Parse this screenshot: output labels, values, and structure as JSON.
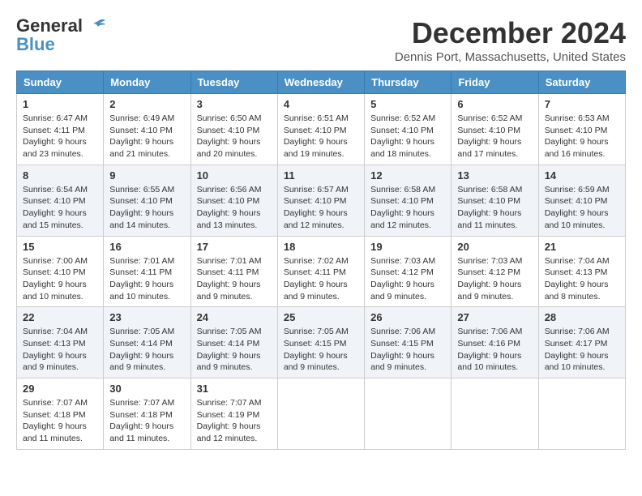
{
  "logo": {
    "line1": "General",
    "line2": "Blue"
  },
  "title": "December 2024",
  "location": "Dennis Port, Massachusetts, United States",
  "days_of_week": [
    "Sunday",
    "Monday",
    "Tuesday",
    "Wednesday",
    "Thursday",
    "Friday",
    "Saturday"
  ],
  "weeks": [
    [
      {
        "day": "1",
        "sunrise": "6:47 AM",
        "sunset": "4:11 PM",
        "daylight": "9 hours and 23 minutes."
      },
      {
        "day": "2",
        "sunrise": "6:49 AM",
        "sunset": "4:10 PM",
        "daylight": "9 hours and 21 minutes."
      },
      {
        "day": "3",
        "sunrise": "6:50 AM",
        "sunset": "4:10 PM",
        "daylight": "9 hours and 20 minutes."
      },
      {
        "day": "4",
        "sunrise": "6:51 AM",
        "sunset": "4:10 PM",
        "daylight": "9 hours and 19 minutes."
      },
      {
        "day": "5",
        "sunrise": "6:52 AM",
        "sunset": "4:10 PM",
        "daylight": "9 hours and 18 minutes."
      },
      {
        "day": "6",
        "sunrise": "6:52 AM",
        "sunset": "4:10 PM",
        "daylight": "9 hours and 17 minutes."
      },
      {
        "day": "7",
        "sunrise": "6:53 AM",
        "sunset": "4:10 PM",
        "daylight": "9 hours and 16 minutes."
      }
    ],
    [
      {
        "day": "8",
        "sunrise": "6:54 AM",
        "sunset": "4:10 PM",
        "daylight": "9 hours and 15 minutes."
      },
      {
        "day": "9",
        "sunrise": "6:55 AM",
        "sunset": "4:10 PM",
        "daylight": "9 hours and 14 minutes."
      },
      {
        "day": "10",
        "sunrise": "6:56 AM",
        "sunset": "4:10 PM",
        "daylight": "9 hours and 13 minutes."
      },
      {
        "day": "11",
        "sunrise": "6:57 AM",
        "sunset": "4:10 PM",
        "daylight": "9 hours and 12 minutes."
      },
      {
        "day": "12",
        "sunrise": "6:58 AM",
        "sunset": "4:10 PM",
        "daylight": "9 hours and 12 minutes."
      },
      {
        "day": "13",
        "sunrise": "6:58 AM",
        "sunset": "4:10 PM",
        "daylight": "9 hours and 11 minutes."
      },
      {
        "day": "14",
        "sunrise": "6:59 AM",
        "sunset": "4:10 PM",
        "daylight": "9 hours and 10 minutes."
      }
    ],
    [
      {
        "day": "15",
        "sunrise": "7:00 AM",
        "sunset": "4:10 PM",
        "daylight": "9 hours and 10 minutes."
      },
      {
        "day": "16",
        "sunrise": "7:01 AM",
        "sunset": "4:11 PM",
        "daylight": "9 hours and 10 minutes."
      },
      {
        "day": "17",
        "sunrise": "7:01 AM",
        "sunset": "4:11 PM",
        "daylight": "9 hours and 9 minutes."
      },
      {
        "day": "18",
        "sunrise": "7:02 AM",
        "sunset": "4:11 PM",
        "daylight": "9 hours and 9 minutes."
      },
      {
        "day": "19",
        "sunrise": "7:03 AM",
        "sunset": "4:12 PM",
        "daylight": "9 hours and 9 minutes."
      },
      {
        "day": "20",
        "sunrise": "7:03 AM",
        "sunset": "4:12 PM",
        "daylight": "9 hours and 9 minutes."
      },
      {
        "day": "21",
        "sunrise": "7:04 AM",
        "sunset": "4:13 PM",
        "daylight": "9 hours and 8 minutes."
      }
    ],
    [
      {
        "day": "22",
        "sunrise": "7:04 AM",
        "sunset": "4:13 PM",
        "daylight": "9 hours and 9 minutes."
      },
      {
        "day": "23",
        "sunrise": "7:05 AM",
        "sunset": "4:14 PM",
        "daylight": "9 hours and 9 minutes."
      },
      {
        "day": "24",
        "sunrise": "7:05 AM",
        "sunset": "4:14 PM",
        "daylight": "9 hours and 9 minutes."
      },
      {
        "day": "25",
        "sunrise": "7:05 AM",
        "sunset": "4:15 PM",
        "daylight": "9 hours and 9 minutes."
      },
      {
        "day": "26",
        "sunrise": "7:06 AM",
        "sunset": "4:15 PM",
        "daylight": "9 hours and 9 minutes."
      },
      {
        "day": "27",
        "sunrise": "7:06 AM",
        "sunset": "4:16 PM",
        "daylight": "9 hours and 10 minutes."
      },
      {
        "day": "28",
        "sunrise": "7:06 AM",
        "sunset": "4:17 PM",
        "daylight": "9 hours and 10 minutes."
      }
    ],
    [
      {
        "day": "29",
        "sunrise": "7:07 AM",
        "sunset": "4:18 PM",
        "daylight": "9 hours and 11 minutes."
      },
      {
        "day": "30",
        "sunrise": "7:07 AM",
        "sunset": "4:18 PM",
        "daylight": "9 hours and 11 minutes."
      },
      {
        "day": "31",
        "sunrise": "7:07 AM",
        "sunset": "4:19 PM",
        "daylight": "9 hours and 12 minutes."
      },
      null,
      null,
      null,
      null
    ]
  ],
  "labels": {
    "sunrise": "Sunrise:",
    "sunset": "Sunset:",
    "daylight": "Daylight:"
  }
}
